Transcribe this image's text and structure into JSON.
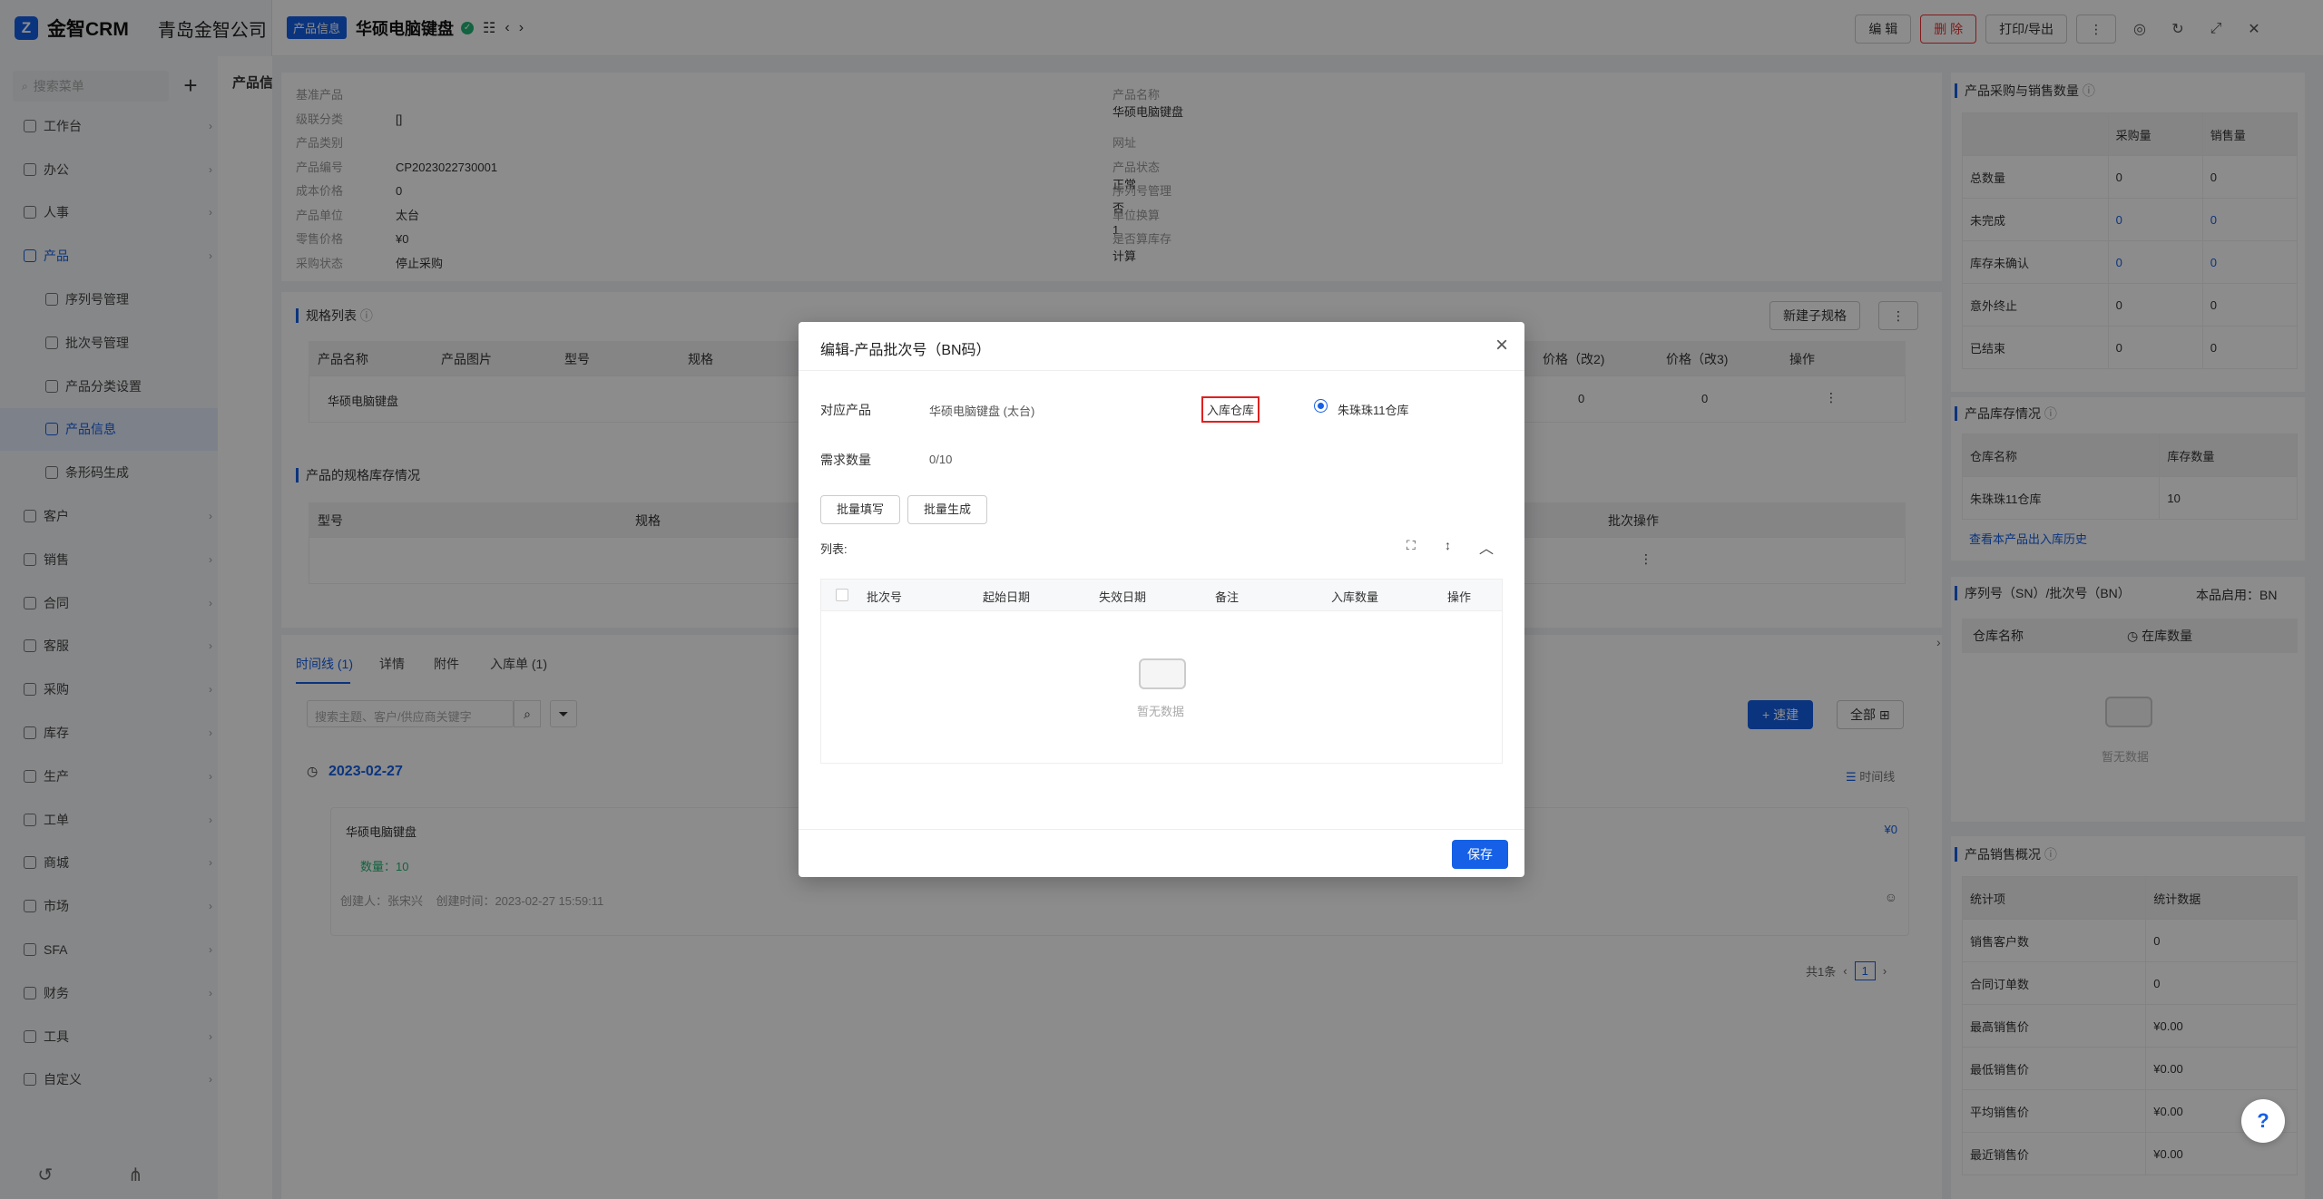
{
  "app": {
    "brand": "金智CRM",
    "company": "青岛金智公司"
  },
  "sidebar": {
    "search_placeholder": "搜索菜单",
    "plus": "+",
    "items": [
      {
        "label": "工作台",
        "level": 0
      },
      {
        "label": "办公",
        "level": 0
      },
      {
        "label": "人事",
        "level": 0
      },
      {
        "label": "产品",
        "level": 0,
        "state": "open"
      },
      {
        "label": "序列号管理",
        "level": 1
      },
      {
        "label": "批次号管理",
        "level": 1
      },
      {
        "label": "产品分类设置",
        "level": 1
      },
      {
        "label": "产品信息",
        "level": 1,
        "state": "active"
      },
      {
        "label": "条形码生成",
        "level": 1
      },
      {
        "label": "客户",
        "level": 0
      },
      {
        "label": "销售",
        "level": 0
      },
      {
        "label": "合同",
        "level": 0
      },
      {
        "label": "客服",
        "level": 0
      },
      {
        "label": "采购",
        "level": 0
      },
      {
        "label": "库存",
        "level": 0
      },
      {
        "label": "生产",
        "level": 0
      },
      {
        "label": "工单",
        "level": 0
      },
      {
        "label": "商城",
        "level": 0
      },
      {
        "label": "市场",
        "level": 0
      },
      {
        "label": "SFA",
        "level": 0
      },
      {
        "label": "财务",
        "level": 0
      },
      {
        "label": "工具",
        "level": 0
      },
      {
        "label": "自定义",
        "level": 0
      }
    ]
  },
  "left_panel": {
    "title": "产品信"
  },
  "topbar": {
    "tag": "产品信息",
    "title": "华硕电脑键盘",
    "btn_edit": "编 辑",
    "btn_delete": "删 除",
    "btn_print": "打印/导出"
  },
  "info": {
    "left": [
      {
        "k": "基准产品",
        "v": ""
      },
      {
        "k": "级联分类",
        "v": "[]"
      },
      {
        "k": "产品类别",
        "v": ""
      },
      {
        "k": "产品编号",
        "v": "CP2023022730001"
      },
      {
        "k": "成本价格",
        "v": "0"
      },
      {
        "k": "产品单位",
        "v": "太台"
      },
      {
        "k": "零售价格",
        "v": "¥0"
      },
      {
        "k": "采购状态",
        "v": "停止采购"
      }
    ],
    "right": [
      {
        "k": "产品名称",
        "v": "华硕电脑键盘"
      },
      {
        "k": "网址",
        "v": ""
      },
      {
        "k": "产品状态",
        "v": "正常"
      },
      {
        "k": "序列号管理",
        "v": "否"
      },
      {
        "k": "单位换算",
        "v": "1"
      },
      {
        "k": "是否算库存",
        "v": "计算"
      }
    ]
  },
  "spec": {
    "title": "规格列表",
    "new_btn": "新建子规格",
    "columns": [
      "产品名称",
      "产品图片",
      "型号",
      "规格",
      "价格（改2)",
      "价格（改3)",
      "操作"
    ],
    "row": {
      "name": "华硕电脑键盘",
      "p2": "0",
      "p3": "0"
    }
  },
  "stock_spec": {
    "title": "产品的规格库存情况",
    "columns": [
      "型号",
      "规格",
      "批次操作"
    ]
  },
  "timeline": {
    "tabs": [
      "时间线 (1)",
      "详情",
      "附件",
      "入库单 (1)"
    ],
    "search_placeholder": "搜索主题、客户/供应商关键字",
    "new_btn": "+ 速建",
    "all_btn": "全部",
    "date": "2023-02-27",
    "timeline_label": "时间线",
    "entry_title": "华硕电脑键盘",
    "entry_qty": "数量：10",
    "entry_amount": "¥0",
    "entry_meta": "创建人：张宋兴    创建时间：2023-02-27 15:59:11",
    "total": "共1条",
    "page": "1"
  },
  "right_panels": {
    "purchase_sales": {
      "title": "产品采购与销售数量",
      "cols": [
        "",
        "采购量",
        "销售量"
      ],
      "rows": [
        [
          "总数量",
          "0",
          "0"
        ],
        [
          "未完成",
          "0",
          "0"
        ],
        [
          "库存未确认",
          "0",
          "0"
        ],
        [
          "意外终止",
          "0",
          "0"
        ],
        [
          "已结束",
          "0",
          "0"
        ]
      ]
    },
    "inventory": {
      "title": "产品库存情况",
      "cols": [
        "仓库名称",
        "库存数量"
      ],
      "rows": [
        [
          "朱珠珠11仓库",
          "10"
        ]
      ],
      "link": "查看本产品出入库历史"
    },
    "sn": {
      "title": "序列号（SN）/批次号（BN）",
      "enabled": "本品启用：BN",
      "cols": [
        "仓库名称",
        "在库数量"
      ],
      "empty": "暂无数据"
    },
    "sales": {
      "title": "产品销售概况",
      "cols": [
        "统计项",
        "统计数据"
      ],
      "rows": [
        [
          "销售客户数",
          "0"
        ],
        [
          "合同订单数",
          "0"
        ],
        [
          "最高销售价",
          "¥0.00"
        ],
        [
          "最低销售价",
          "¥0.00"
        ],
        [
          "平均销售价",
          "¥0.00"
        ],
        [
          "最近销售价",
          "¥0.00"
        ]
      ]
    }
  },
  "modal": {
    "title": "编辑-产品批次号（BN码）",
    "product_label": "对应产品",
    "product_value": "华硕电脑键盘 (太台)",
    "warehouse_label": "入库仓库",
    "warehouse_option": "朱珠珠11仓库",
    "qty_label": "需求数量",
    "qty_value": "0/10",
    "btn_batch_fill": "批量填写",
    "btn_batch_gen": "批量生成",
    "list_label": "列表:",
    "columns": [
      "批次号",
      "起始日期",
      "失效日期",
      "备注",
      "入库数量",
      "操作"
    ],
    "empty": "暂无数据",
    "save": "保存"
  },
  "colors": {
    "primary": "#1560e6",
    "danger": "#e02020",
    "success": "#22b573"
  }
}
